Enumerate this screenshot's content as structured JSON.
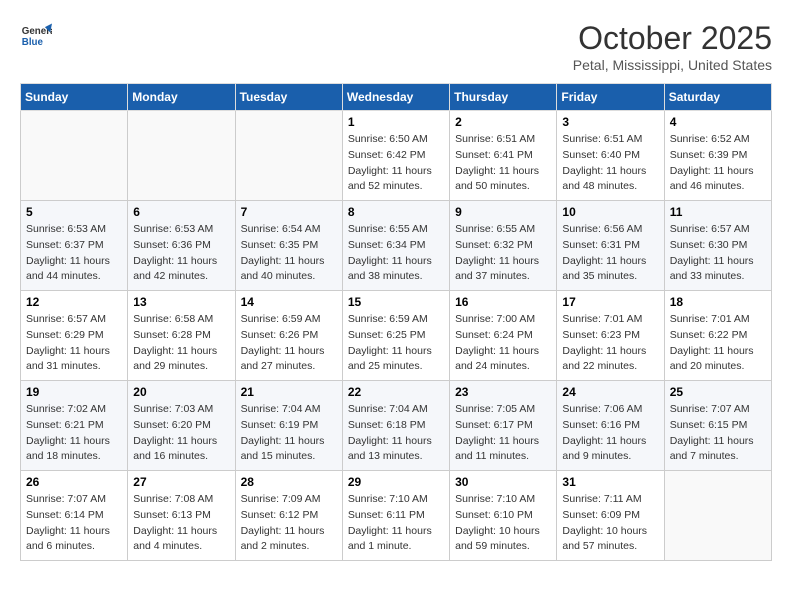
{
  "logo": {
    "line1": "General",
    "line2": "Blue"
  },
  "title": "October 2025",
  "subtitle": "Petal, Mississippi, United States",
  "weekdays": [
    "Sunday",
    "Monday",
    "Tuesday",
    "Wednesday",
    "Thursday",
    "Friday",
    "Saturday"
  ],
  "weeks": [
    [
      {
        "day": "",
        "info": ""
      },
      {
        "day": "",
        "info": ""
      },
      {
        "day": "",
        "info": ""
      },
      {
        "day": "1",
        "info": "Sunrise: 6:50 AM\nSunset: 6:42 PM\nDaylight: 11 hours\nand 52 minutes."
      },
      {
        "day": "2",
        "info": "Sunrise: 6:51 AM\nSunset: 6:41 PM\nDaylight: 11 hours\nand 50 minutes."
      },
      {
        "day": "3",
        "info": "Sunrise: 6:51 AM\nSunset: 6:40 PM\nDaylight: 11 hours\nand 48 minutes."
      },
      {
        "day": "4",
        "info": "Sunrise: 6:52 AM\nSunset: 6:39 PM\nDaylight: 11 hours\nand 46 minutes."
      }
    ],
    [
      {
        "day": "5",
        "info": "Sunrise: 6:53 AM\nSunset: 6:37 PM\nDaylight: 11 hours\nand 44 minutes."
      },
      {
        "day": "6",
        "info": "Sunrise: 6:53 AM\nSunset: 6:36 PM\nDaylight: 11 hours\nand 42 minutes."
      },
      {
        "day": "7",
        "info": "Sunrise: 6:54 AM\nSunset: 6:35 PM\nDaylight: 11 hours\nand 40 minutes."
      },
      {
        "day": "8",
        "info": "Sunrise: 6:55 AM\nSunset: 6:34 PM\nDaylight: 11 hours\nand 38 minutes."
      },
      {
        "day": "9",
        "info": "Sunrise: 6:55 AM\nSunset: 6:32 PM\nDaylight: 11 hours\nand 37 minutes."
      },
      {
        "day": "10",
        "info": "Sunrise: 6:56 AM\nSunset: 6:31 PM\nDaylight: 11 hours\nand 35 minutes."
      },
      {
        "day": "11",
        "info": "Sunrise: 6:57 AM\nSunset: 6:30 PM\nDaylight: 11 hours\nand 33 minutes."
      }
    ],
    [
      {
        "day": "12",
        "info": "Sunrise: 6:57 AM\nSunset: 6:29 PM\nDaylight: 11 hours\nand 31 minutes."
      },
      {
        "day": "13",
        "info": "Sunrise: 6:58 AM\nSunset: 6:28 PM\nDaylight: 11 hours\nand 29 minutes."
      },
      {
        "day": "14",
        "info": "Sunrise: 6:59 AM\nSunset: 6:26 PM\nDaylight: 11 hours\nand 27 minutes."
      },
      {
        "day": "15",
        "info": "Sunrise: 6:59 AM\nSunset: 6:25 PM\nDaylight: 11 hours\nand 25 minutes."
      },
      {
        "day": "16",
        "info": "Sunrise: 7:00 AM\nSunset: 6:24 PM\nDaylight: 11 hours\nand 24 minutes."
      },
      {
        "day": "17",
        "info": "Sunrise: 7:01 AM\nSunset: 6:23 PM\nDaylight: 11 hours\nand 22 minutes."
      },
      {
        "day": "18",
        "info": "Sunrise: 7:01 AM\nSunset: 6:22 PM\nDaylight: 11 hours\nand 20 minutes."
      }
    ],
    [
      {
        "day": "19",
        "info": "Sunrise: 7:02 AM\nSunset: 6:21 PM\nDaylight: 11 hours\nand 18 minutes."
      },
      {
        "day": "20",
        "info": "Sunrise: 7:03 AM\nSunset: 6:20 PM\nDaylight: 11 hours\nand 16 minutes."
      },
      {
        "day": "21",
        "info": "Sunrise: 7:04 AM\nSunset: 6:19 PM\nDaylight: 11 hours\nand 15 minutes."
      },
      {
        "day": "22",
        "info": "Sunrise: 7:04 AM\nSunset: 6:18 PM\nDaylight: 11 hours\nand 13 minutes."
      },
      {
        "day": "23",
        "info": "Sunrise: 7:05 AM\nSunset: 6:17 PM\nDaylight: 11 hours\nand 11 minutes."
      },
      {
        "day": "24",
        "info": "Sunrise: 7:06 AM\nSunset: 6:16 PM\nDaylight: 11 hours\nand 9 minutes."
      },
      {
        "day": "25",
        "info": "Sunrise: 7:07 AM\nSunset: 6:15 PM\nDaylight: 11 hours\nand 7 minutes."
      }
    ],
    [
      {
        "day": "26",
        "info": "Sunrise: 7:07 AM\nSunset: 6:14 PM\nDaylight: 11 hours\nand 6 minutes."
      },
      {
        "day": "27",
        "info": "Sunrise: 7:08 AM\nSunset: 6:13 PM\nDaylight: 11 hours\nand 4 minutes."
      },
      {
        "day": "28",
        "info": "Sunrise: 7:09 AM\nSunset: 6:12 PM\nDaylight: 11 hours\nand 2 minutes."
      },
      {
        "day": "29",
        "info": "Sunrise: 7:10 AM\nSunset: 6:11 PM\nDaylight: 11 hours\nand 1 minute."
      },
      {
        "day": "30",
        "info": "Sunrise: 7:10 AM\nSunset: 6:10 PM\nDaylight: 10 hours\nand 59 minutes."
      },
      {
        "day": "31",
        "info": "Sunrise: 7:11 AM\nSunset: 6:09 PM\nDaylight: 10 hours\nand 57 minutes."
      },
      {
        "day": "",
        "info": ""
      }
    ]
  ]
}
